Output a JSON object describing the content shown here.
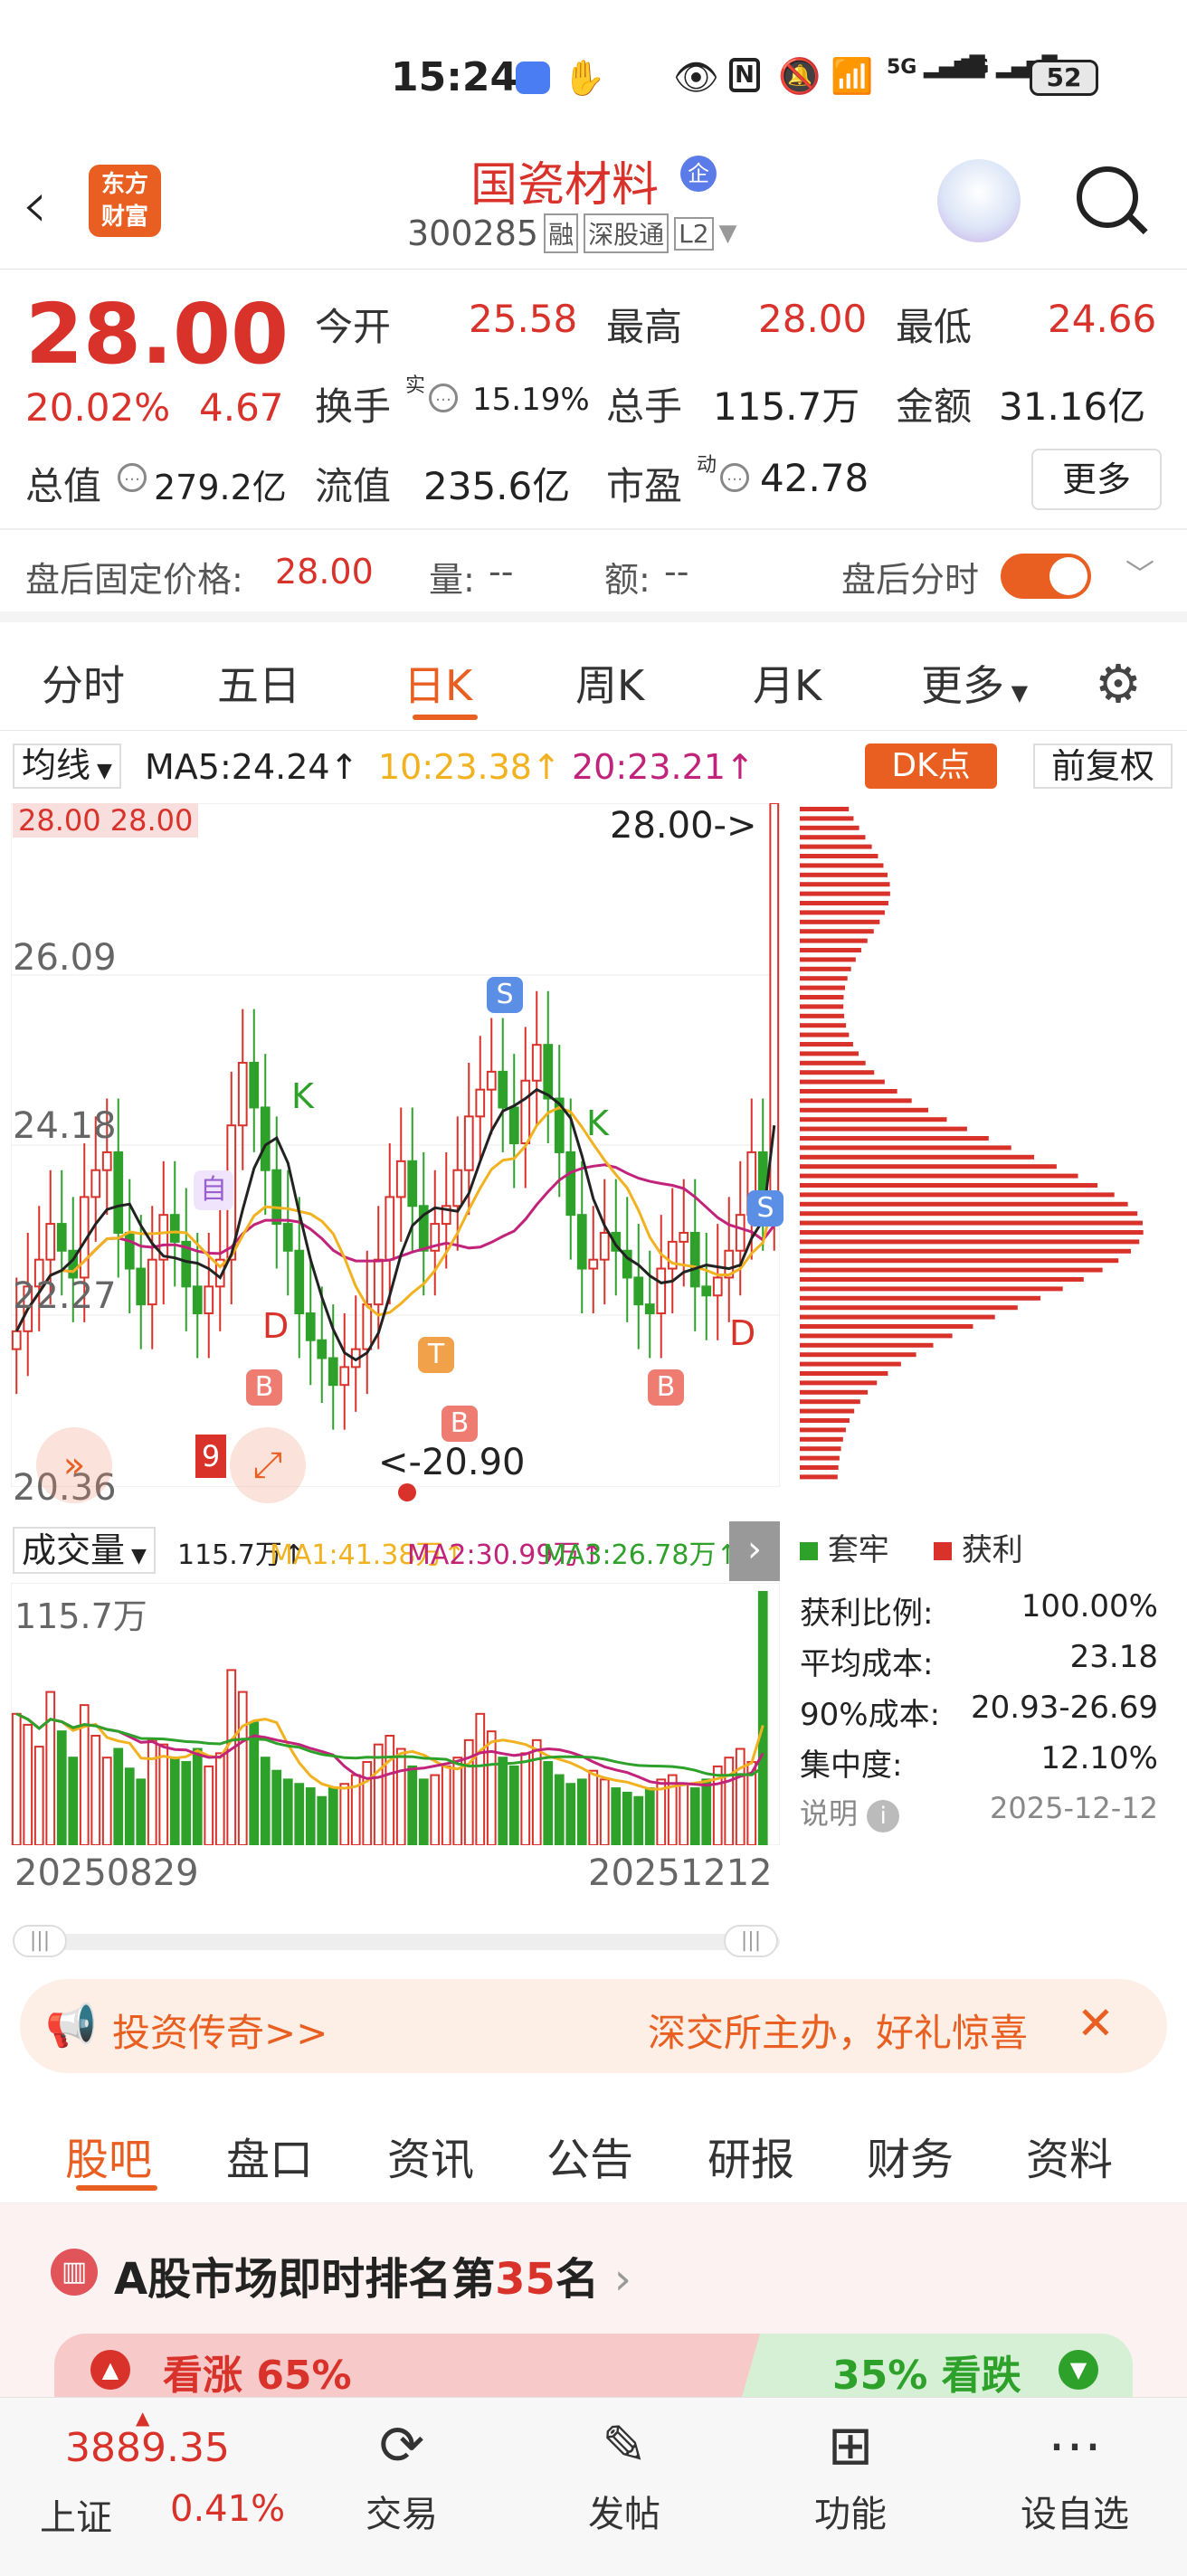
{
  "status": {
    "time": "15:24",
    "sig1": "5G",
    "sig2": "5G",
    "battery": "52"
  },
  "header": {
    "logo_line1": "东方",
    "logo_line2": "财富",
    "title": "国瓷材料",
    "badge": "企",
    "code": "300285",
    "tag1": "融",
    "tag2": "深股通",
    "tag3": "L2"
  },
  "quote": {
    "price": "28.00",
    "pct": "20.02%",
    "chg": "4.67",
    "open_label": "今开",
    "open": "25.58",
    "high_label": "最高",
    "high": "28.00",
    "low_label": "最低",
    "low": "24.66",
    "turnover_label": "换手",
    "turnover_sup": "实",
    "turnover": "15.19%",
    "vol_label": "总手",
    "vol": "115.7万",
    "amount_label": "金额",
    "amount": "31.16亿",
    "mcap_label": "总值",
    "mcap": "279.2亿",
    "float_label": "流值",
    "float": "235.6亿",
    "pe_label": "市盈",
    "pe_sup": "动",
    "pe": "42.78",
    "more": "更多",
    "after_price_label": "盘后固定价格:",
    "after_price": "28.00",
    "after_vol_label": "量:",
    "after_vol": "--",
    "after_amt_label": "额:",
    "after_amt": "--",
    "after_time_label": "盘后分时"
  },
  "tabs": [
    "分时",
    "五日",
    "日K",
    "周K",
    "月K",
    "更多"
  ],
  "chart": {
    "ma_select": "均线",
    "ma5": "MA5:24.24↑",
    "ma10": "10:23.38↑",
    "ma20": "20:23.21↑",
    "dk": "DK点",
    "fq": "前复权",
    "ylabels": [
      "28.00",
      "26.09",
      "24.18",
      "22.27",
      "20.36"
    ],
    "topbox": "28.00 28.00",
    "max_label": "28.00->",
    "min_label": "<-20.90",
    "vol_select": "成交量",
    "vol_info": "115.7万↑",
    "vma1": "MA1:41.38万↑",
    "vma2": "MA2:30.99万↑",
    "vma3": "MA3:26.78万↑",
    "vol_max": "115.7万",
    "date_start": "20250829",
    "date_end": "20251212",
    "marker_K": "K",
    "marker_S": "S",
    "marker_B": "B",
    "marker_D": "D",
    "marker_T": "T",
    "marker_self": "自",
    "marker_9": "9"
  },
  "chips": {
    "legend_trap": "套牢",
    "legend_profit": "获利",
    "rows": [
      {
        "label": "获利比例:",
        "value": "100.00%"
      },
      {
        "label": "平均成本:",
        "value": "23.18"
      },
      {
        "label": "90%成本:",
        "value": "20.93-26.69"
      },
      {
        "label": "集中度:",
        "value": "12.10%"
      }
    ],
    "note": "说明",
    "date": "2025-12-12"
  },
  "banner": {
    "left": "投资传奇>>",
    "right": "深交所主办，好礼惊喜"
  },
  "lower_tabs": [
    "股吧",
    "盘口",
    "资讯",
    "公告",
    "研报",
    "财务",
    "资料"
  ],
  "rank": {
    "prefix": "A股市场即时排名第",
    "num": "35",
    "suffix": "名",
    "up": "看涨 65%",
    "down": "35% 看跌"
  },
  "index": {
    "value": "3889.35",
    "name": "上证",
    "pct": "0.41%"
  },
  "nav": [
    "交易",
    "发帖",
    "功能",
    "设自选"
  ],
  "colors": {
    "red": "#d9322b",
    "green": "#2ea12a",
    "orange": "#e95f21",
    "yellow": "#f2b11f",
    "magenta": "#c2237a"
  },
  "chart_data": {
    "type": "candlestick",
    "ylim": [
      20.36,
      28.0
    ],
    "x_range": [
      "20250829",
      "20251212"
    ],
    "close": [
      22.1,
      22.6,
      22.9,
      23.3,
      23.0,
      22.7,
      23.6,
      23.9,
      24.1,
      23.2,
      22.8,
      22.4,
      22.9,
      23.4,
      23.1,
      22.6,
      22.3,
      22.6,
      22.9,
      24.4,
      25.1,
      24.6,
      23.9,
      23.3,
      23.0,
      22.3,
      22.0,
      21.8,
      21.5,
      21.7,
      21.9,
      22.4,
      22.9,
      23.6,
      24.0,
      23.5,
      23.0,
      23.3,
      23.5,
      23.9,
      24.5,
      24.8,
      25.0,
      24.6,
      24.2,
      24.9,
      25.3,
      24.7,
      24.1,
      23.4,
      22.8,
      22.9,
      23.2,
      23.0,
      22.7,
      22.4,
      22.3,
      22.8,
      23.1,
      23.2,
      22.6,
      22.5,
      22.7,
      23.0,
      23.4,
      24.1,
      23.5,
      28.0
    ],
    "volume": [
      60,
      55,
      45,
      70,
      52,
      40,
      64,
      50,
      40,
      44,
      35,
      30,
      48,
      46,
      40,
      38,
      44,
      36,
      42,
      80,
      70,
      56,
      40,
      34,
      30,
      28,
      26,
      22,
      26,
      28,
      32,
      38,
      46,
      50,
      44,
      36,
      30,
      32,
      36,
      40,
      48,
      60,
      52,
      40,
      36,
      42,
      48,
      38,
      32,
      28,
      30,
      34,
      30,
      26,
      24,
      22,
      26,
      30,
      32,
      28,
      26,
      30,
      36,
      40,
      44,
      38,
      115.7
    ]
  }
}
